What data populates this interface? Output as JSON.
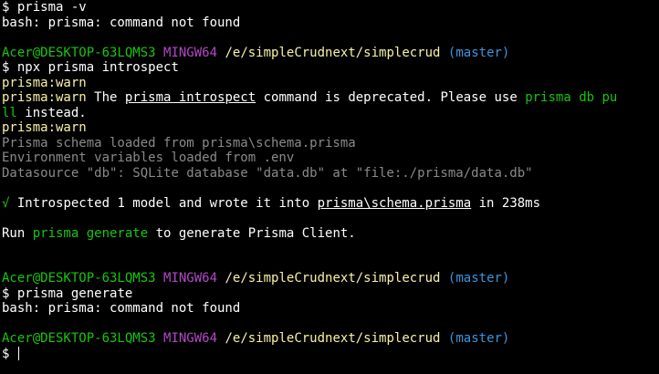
{
  "colors": {
    "background": "#000000",
    "text": "#ffffff",
    "green": "#16c60c",
    "warn_yellow": "#f9f1a5",
    "magenta": "#b148c6",
    "cyan": "#3a96dd",
    "dim": "#8a8a8a"
  },
  "prompt": {
    "user_host": "Acer@DESKTOP-63LQMS3",
    "env": "MINGW64",
    "path": "/e/simpleCrudnext/simplecrud",
    "branch": "(master)",
    "symbol": "$"
  },
  "lines": {
    "cmd1": "prisma -v",
    "out1": "bash: prisma: command not found",
    "cmd2": "npx prisma introspect",
    "warn_tag": "prisma:warn",
    "warn_text_1": "The ",
    "warn_cmd": "prisma introspect",
    "warn_text_2": " command is deprecated. Please use ",
    "warn_alt": "prisma db pu",
    "warn_alt_wrap": "ll",
    "warn_text_3": " instead.",
    "schema_loaded": "Prisma schema loaded from prisma\\schema.prisma",
    "env_loaded": "Environment variables loaded from .env",
    "datasource": "Datasource \"db\": SQLite database \"data.db\" at \"file:./prisma/data.db\"",
    "check_mark": "√",
    "introspected_1": " Introspected 1 model and wrote it into ",
    "introspected_file": "prisma\\schema.prisma",
    "introspected_2": " in 238ms",
    "run_1": "Run ",
    "run_cmd": "prisma generate",
    "run_2": " to generate Prisma Client.",
    "cmd3": "prisma generate",
    "out3": "bash: prisma: command not found"
  }
}
